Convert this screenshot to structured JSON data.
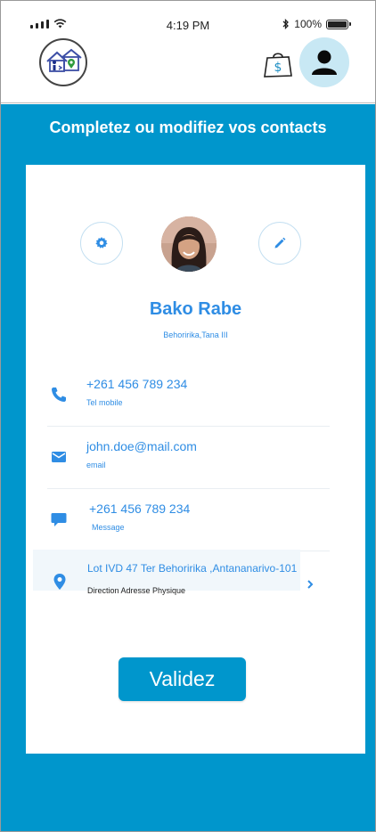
{
  "status_bar": {
    "time": "4:19 PM",
    "battery": "100%"
  },
  "colors": {
    "primary_blue": "#0096cc",
    "accent_text": "#2f8de4",
    "avatar_bg": "#c8e8f4"
  },
  "header": {
    "icons": [
      "app-logo-icon",
      "shopping-bag-dollar-icon",
      "user-avatar-icon"
    ]
  },
  "page": {
    "title": "Completez ou modifiez vos contacts"
  },
  "profile": {
    "name": "Bako Rabe",
    "location": "Behoririka,Tana III"
  },
  "contacts": [
    {
      "icon": "phone-icon",
      "value": "+261 456 789 234",
      "label": "Tel mobile"
    },
    {
      "icon": "email-icon",
      "value": "john.doe@mail.com",
      "label": "email"
    },
    {
      "icon": "message-icon",
      "value": "+261 456 789 234",
      "label": "Message"
    }
  ],
  "address": {
    "icon": "location-pin-icon",
    "value": "Lot IVD 47 Ter Behoririka ,Antananarivo-101",
    "label": "Direction Adresse Physique"
  },
  "actions": {
    "validate_label": "Validez"
  }
}
